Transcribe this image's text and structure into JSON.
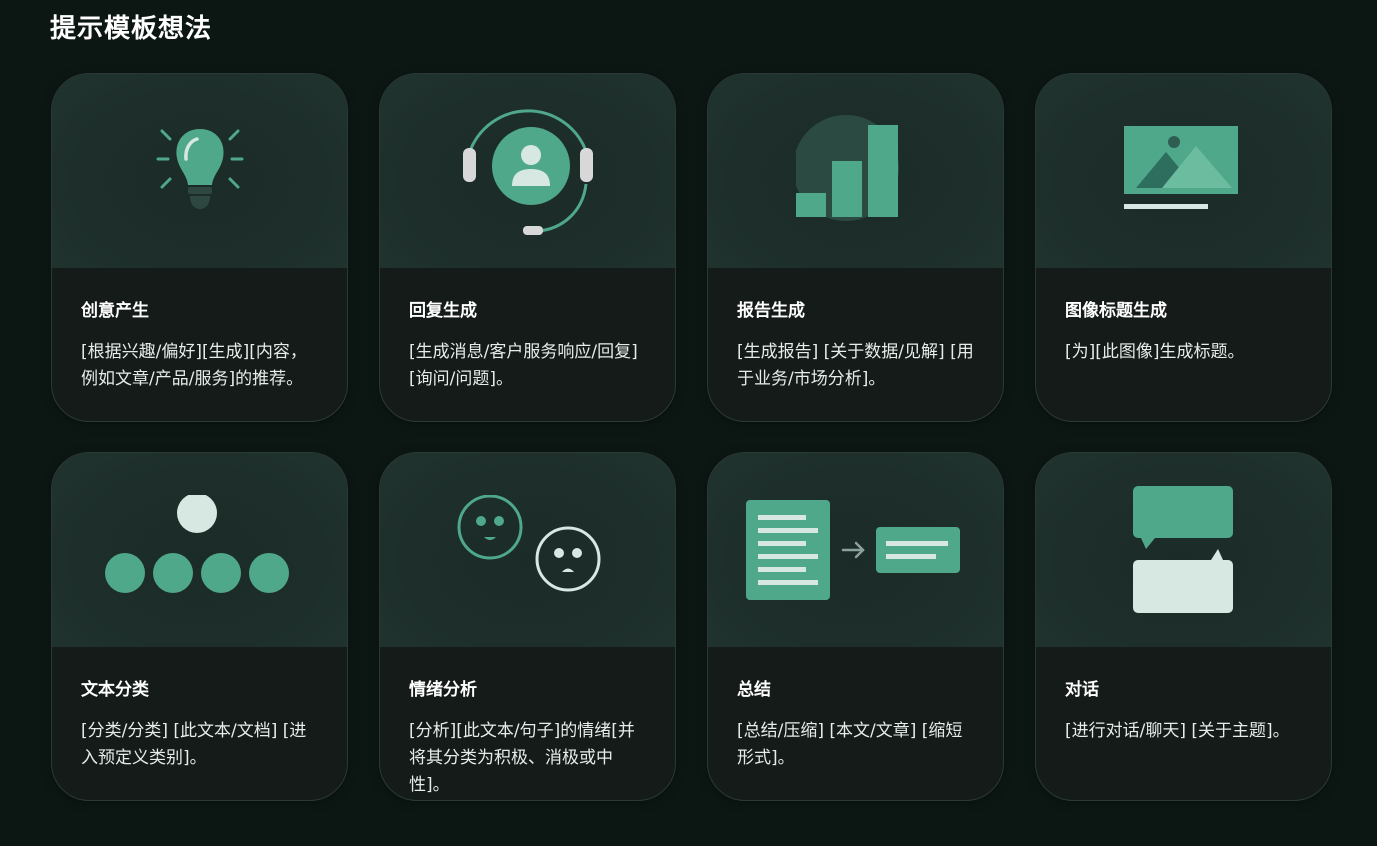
{
  "page": {
    "title": "提示模板想法"
  },
  "colors": {
    "background": "#0c1714",
    "accent": "#4fa88a",
    "light": "#d6e8e1"
  },
  "cards": [
    {
      "icon": "lightbulb-icon",
      "title": "创意产生",
      "desc": "[根据兴趣/偏好][生成][内容，例如文章/产品/服务]的推荐。"
    },
    {
      "icon": "headset-icon",
      "title": "回复生成",
      "desc": "[生成消息/客户服务响应/回复][询问/问题]。"
    },
    {
      "icon": "bar-chart-icon",
      "title": "报告生成",
      "desc": "[生成报告] [关于数据/见解] [用于业务/市场分析]。"
    },
    {
      "icon": "image-icon",
      "title": "图像标题生成",
      "desc": "[为][此图像]生成标题。"
    },
    {
      "icon": "hierarchy-icon",
      "title": "文本分类",
      "desc": "[分类/分类] [此文本/文档] [进入预定义类别]。"
    },
    {
      "icon": "emotion-faces-icon",
      "title": "情绪分析",
      "desc": "[分析][此文本/句子]的情绪[并将其分类为积极、消极或中性]。"
    },
    {
      "icon": "summarize-document-icon",
      "title": "总结",
      "desc": "[总结/压缩] [本文/文章] [缩短形式]。"
    },
    {
      "icon": "chat-bubbles-icon",
      "title": "对话",
      "desc": "[进行对话/聊天] [关于主题]。"
    }
  ]
}
